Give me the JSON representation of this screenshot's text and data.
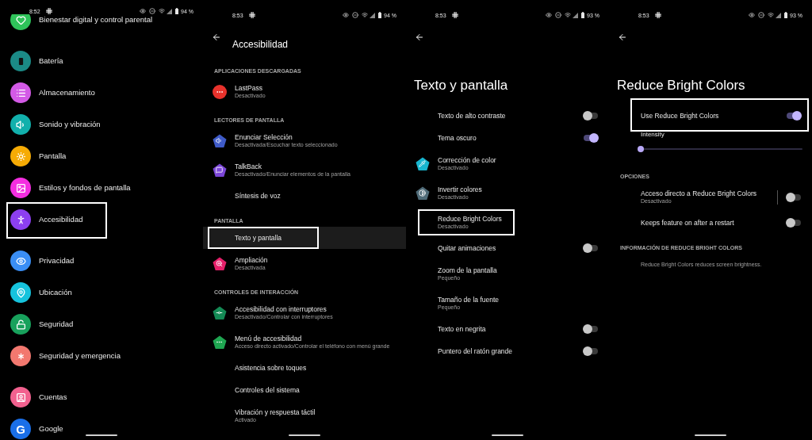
{
  "screens": [
    {
      "kind": "home",
      "status": {
        "time": "8:52",
        "battery": "94 %"
      },
      "groups": [
        {
          "items": [
            {
              "title": "Bienestar digital y control parental",
              "color": "#2fc35a",
              "outlined": false
            }
          ]
        },
        {
          "items": [
            {
              "title": "Batería",
              "color": "#1b8a86",
              "outlined": false
            },
            {
              "title": "Almacenamiento",
              "color": "#d35ae6",
              "outlined": false
            },
            {
              "title": "Sonido y vibración",
              "color": "#12b0ac",
              "outlined": false
            },
            {
              "title": "Pantalla",
              "color": "#f6ab05",
              "outlined": false
            },
            {
              "title": "Estilos y fondos de pantalla",
              "color": "#f42ee0",
              "outlined": false
            },
            {
              "title": "Accesibilidad",
              "color": "#8c3ff0",
              "outlined": true
            }
          ]
        },
        {
          "items": [
            {
              "title": "Privacidad",
              "color": "#3a8ef5",
              "outlined": false
            },
            {
              "title": "Ubicación",
              "color": "#16c3dd",
              "outlined": false
            },
            {
              "title": "Seguridad",
              "color": "#18a15c",
              "outlined": false
            },
            {
              "title": "Seguridad y emergencia",
              "color": "#f2786f",
              "outlined": false
            }
          ]
        },
        {
          "items": [
            {
              "title": "Cuentas",
              "color": "#f2618f",
              "outlined": false
            },
            {
              "title": "Google",
              "glyph": "G",
              "color": "#1a6fe8",
              "outlined": false
            }
          ]
        }
      ]
    },
    {
      "kind": "sub",
      "status": {
        "time": "8:53",
        "battery": "94 %"
      },
      "title": "Accesibilidad",
      "rows": [
        {
          "kind": "header",
          "text": "APLICACIONES DESCARGADAS"
        },
        {
          "kind": "item",
          "title": "LastPass",
          "subtitle": "Desactivado",
          "color": "#e8322c",
          "outlined": false,
          "highlighted": false
        },
        {
          "kind": "header",
          "text": "LECTORES DE PANTALLA"
        },
        {
          "kind": "item",
          "title": "Enunciar Selección",
          "subtitle": "Desactivada/Escuchar texto seleccionado",
          "color": "#3f5bc8",
          "outlined": false,
          "highlighted": false
        },
        {
          "kind": "item",
          "title": "TalkBack",
          "subtitle": "Desactivado/Enunciar elementos de la pantalla",
          "color": "#7a45d6",
          "outlined": false,
          "highlighted": false
        },
        {
          "kind": "item",
          "title": "Síntesis de voz",
          "outlined": false,
          "highlighted": false
        },
        {
          "kind": "header",
          "text": "PANTALLA"
        },
        {
          "kind": "item",
          "title": "Texto y pantalla",
          "outlined": true,
          "highlighted": true
        },
        {
          "kind": "item",
          "title": "Ampliación",
          "subtitle": "Desactivada",
          "color": "#e5206a",
          "outlined": false,
          "highlighted": false
        },
        {
          "kind": "header",
          "text": "CONTROLES DE INTERACCIÓN"
        },
        {
          "kind": "item",
          "title": "Accesibilidad con interruptores",
          "subtitle": "Desactivado/Controlar con interruptores",
          "color": "#148a55",
          "outlined": false,
          "highlighted": false
        },
        {
          "kind": "item",
          "title": "Menú de accesibilidad",
          "subtitle": "Acceso directo activado/Controlar el teléfono con menú grande",
          "color": "#1fa651",
          "outlined": false,
          "highlighted": false
        },
        {
          "kind": "item",
          "title": "Asistencia sobre toques",
          "outlined": false,
          "highlighted": false
        },
        {
          "kind": "item",
          "title": "Controles del sistema",
          "outlined": false,
          "highlighted": false
        },
        {
          "kind": "item",
          "title": "Vibración y respuesta táctil",
          "subtitle": "Activado",
          "outlined": false,
          "highlighted": false
        }
      ]
    },
    {
      "kind": "detail",
      "status": {
        "time": "8:53",
        "battery": "93 %"
      },
      "title": "Texto y pantalla",
      "rows": [
        {
          "kind": "switch",
          "title": "Texto de alto contraste",
          "on": false,
          "outlined": false
        },
        {
          "kind": "switch",
          "title": "Tema oscuro",
          "on": true,
          "outlined": false
        },
        {
          "kind": "item",
          "title": "Corrección de color",
          "subtitle": "Desactivado",
          "color": "#18b6d0",
          "outlined": false
        },
        {
          "kind": "item",
          "title": "Invertir colores",
          "subtitle": "Desactivado",
          "color": "#4f6b78",
          "outlined": false
        },
        {
          "kind": "item",
          "title": "Reduce Bright Colors",
          "subtitle": "Desactivado",
          "outlined": true
        },
        {
          "kind": "switch",
          "title": "Quitar animaciones",
          "on": false,
          "outlined": false
        },
        {
          "kind": "item",
          "title": "Zoom de la pantalla",
          "subtitle": "Pequeño",
          "outlined": false
        },
        {
          "kind": "item",
          "title": "Tamaño de la fuente",
          "subtitle": "Pequeño",
          "outlined": false
        },
        {
          "kind": "switch",
          "title": "Texto en negrita",
          "on": false,
          "outlined": false
        },
        {
          "kind": "switch",
          "title": "Puntero del ratón grande",
          "on": false,
          "outlined": false
        }
      ]
    },
    {
      "kind": "detail",
      "status": {
        "time": "8:53",
        "battery": "93 %"
      },
      "title": "Reduce Bright Colors",
      "rows": [
        {
          "kind": "switch",
          "title": "Use Reduce Bright Colors",
          "on": true,
          "outlined": true
        },
        {
          "kind": "slider",
          "title": "Intensity",
          "level": 0
        },
        {
          "kind": "header",
          "text": "OPCIONES"
        },
        {
          "kind": "split_switch",
          "title": "Acceso directo a Reduce Bright Colors",
          "subtitle": "Desactivado",
          "on": false,
          "outlined": false
        },
        {
          "kind": "switch",
          "title": "Keeps feature on after a restart",
          "on": false,
          "outlined": false
        },
        {
          "kind": "header",
          "text": "INFORMACIÓN DE REDUCE BRIGHT COLORS"
        },
        {
          "kind": "note",
          "text": "Reduce Bright Colors reduces screen brightness."
        }
      ]
    }
  ]
}
